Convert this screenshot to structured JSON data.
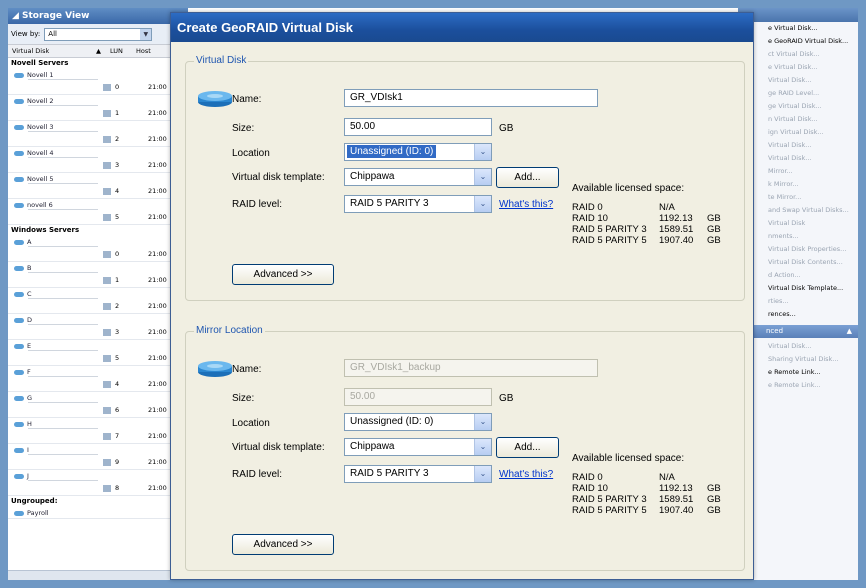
{
  "storage_view": {
    "title": "Storage View",
    "view_by_label": "View by:",
    "view_by_value": "All",
    "columns": [
      "Virtual Disk",
      "LUN",
      "Host"
    ],
    "groups": [
      {
        "name": "Novell Servers",
        "nodes": [
          {
            "name": "Novell 1",
            "lun": "0",
            "host": "21:00"
          },
          {
            "name": "Novell 2",
            "lun": "1",
            "host": "21:00"
          },
          {
            "name": "Novell 3",
            "lun": "2",
            "host": "21:00"
          },
          {
            "name": "Novell 4",
            "lun": "3",
            "host": "21:00"
          },
          {
            "name": "Novell 5",
            "lun": "4",
            "host": "21:00"
          },
          {
            "name": "novell 6",
            "lun": "5",
            "host": "21:00"
          }
        ]
      },
      {
        "name": "Windows Servers",
        "nodes": [
          {
            "name": "A",
            "lun": "0",
            "host": "21:00"
          },
          {
            "name": "B",
            "lun": "1",
            "host": "21:00"
          },
          {
            "name": "C",
            "lun": "2",
            "host": "21:00"
          },
          {
            "name": "D",
            "lun": "3",
            "host": "21:00"
          },
          {
            "name": "E",
            "lun": "5",
            "host": "21:00"
          },
          {
            "name": "F",
            "lun": "4",
            "host": "21:00"
          },
          {
            "name": "G",
            "lun": "6",
            "host": "21:00"
          },
          {
            "name": "H",
            "lun": "7",
            "host": "21:00"
          },
          {
            "name": "I",
            "lun": "9",
            "host": "21:00"
          },
          {
            "name": "J",
            "lun": "8",
            "host": "21:00"
          }
        ]
      },
      {
        "name": "Ungrouped:",
        "nodes": [
          {
            "name": "Payroll",
            "lun": "",
            "host": ""
          }
        ]
      }
    ]
  },
  "task_pane": {
    "items_top": [
      {
        "label": "e Virtual Disk...",
        "enabled": true
      },
      {
        "label": "e GeoRAID Virtual Disk...",
        "enabled": true
      },
      {
        "label": "ct Virtual Disk...",
        "enabled": false
      },
      {
        "label": "e Virtual Disk...",
        "enabled": false
      },
      {
        "label": "Virtual Disk...",
        "enabled": false
      },
      {
        "label": "ge RAID Level...",
        "enabled": false
      },
      {
        "label": "ge Virtual Disk...",
        "enabled": false
      },
      {
        "label": "n Virtual Disk...",
        "enabled": false
      },
      {
        "label": "ign Virtual Disk...",
        "enabled": false
      },
      {
        "label": "Virtual Disk...",
        "enabled": false
      },
      {
        "label": "Virtual Disk...",
        "enabled": false
      },
      {
        "label": "Mirror...",
        "enabled": false
      },
      {
        "label": "k Mirror...",
        "enabled": false
      },
      {
        "label": "te Mirror...",
        "enabled": false
      },
      {
        "label": "and Swap Virtual Disks...",
        "enabled": false
      },
      {
        "label": "Virtual Disk",
        "enabled": false
      },
      {
        "label": "nments...",
        "enabled": false
      },
      {
        "label": "Virtual Disk Properties...",
        "enabled": false
      },
      {
        "label": "Virtual Disk Contents...",
        "enabled": false
      },
      {
        "label": "d Action...",
        "enabled": false
      },
      {
        "label": "Virtual Disk Template...",
        "enabled": true
      },
      {
        "label": "rties...",
        "enabled": false
      },
      {
        "label": "rences...",
        "enabled": true
      }
    ],
    "section2_title": "nced",
    "items_bottom": [
      {
        "label": "Virtual Disk...",
        "enabled": false
      },
      {
        "label": "Sharing Virtual Disk...",
        "enabled": false
      },
      {
        "label": "e Remote Link...",
        "enabled": true
      },
      {
        "label": "e Remote Link...",
        "enabled": false
      }
    ]
  },
  "dialog": {
    "title": "Create GeoRAID Virtual Disk",
    "virtual_disk": {
      "legend": "Virtual Disk",
      "name_label": "Name:",
      "name_value": "GR_VDIsk1",
      "size_label": "Size:",
      "size_value": "50.00",
      "size_unit": "GB",
      "location_label": "Location",
      "location_value": "Unassigned (ID: 0)",
      "template_label": "Virtual disk template:",
      "template_value": "Chippawa",
      "add_button": "Add...",
      "raid_label": "RAID level:",
      "raid_value": "RAID 5 PARITY 3",
      "whats_this": "What's this?",
      "advanced_button": "Advanced >>",
      "licensed_title": "Available licensed space:",
      "licensed_rows": [
        {
          "level": "RAID 0",
          "amount": "N/A",
          "unit": ""
        },
        {
          "level": "RAID 10",
          "amount": "1192.13",
          "unit": "GB"
        },
        {
          "level": "RAID 5 PARITY 3",
          "amount": "1589.51",
          "unit": "GB"
        },
        {
          "level": "RAID 5 PARITY 5",
          "amount": "1907.40",
          "unit": "GB"
        }
      ]
    },
    "mirror_location": {
      "legend": "Mirror Location",
      "name_label": "Name:",
      "name_value": "GR_VDIsk1_backup",
      "size_label": "Size:",
      "size_value": "50.00",
      "size_unit": "GB",
      "location_label": "Location",
      "location_value": "Unassigned (ID: 0)",
      "template_label": "Virtual disk template:",
      "template_value": "Chippawa",
      "add_button": "Add...",
      "raid_label": "RAID level:",
      "raid_value": "RAID 5 PARITY 3",
      "whats_this": "What's this?",
      "advanced_button": "Advanced >>",
      "licensed_title": "Available licensed space:",
      "licensed_rows": [
        {
          "level": "RAID 0",
          "amount": "N/A",
          "unit": ""
        },
        {
          "level": "RAID 10",
          "amount": "1192.13",
          "unit": "GB"
        },
        {
          "level": "RAID 5 PARITY 3",
          "amount": "1589.51",
          "unit": "GB"
        },
        {
          "level": "RAID 5 PARITY 5",
          "amount": "1907.40",
          "unit": "GB"
        }
      ]
    }
  }
}
